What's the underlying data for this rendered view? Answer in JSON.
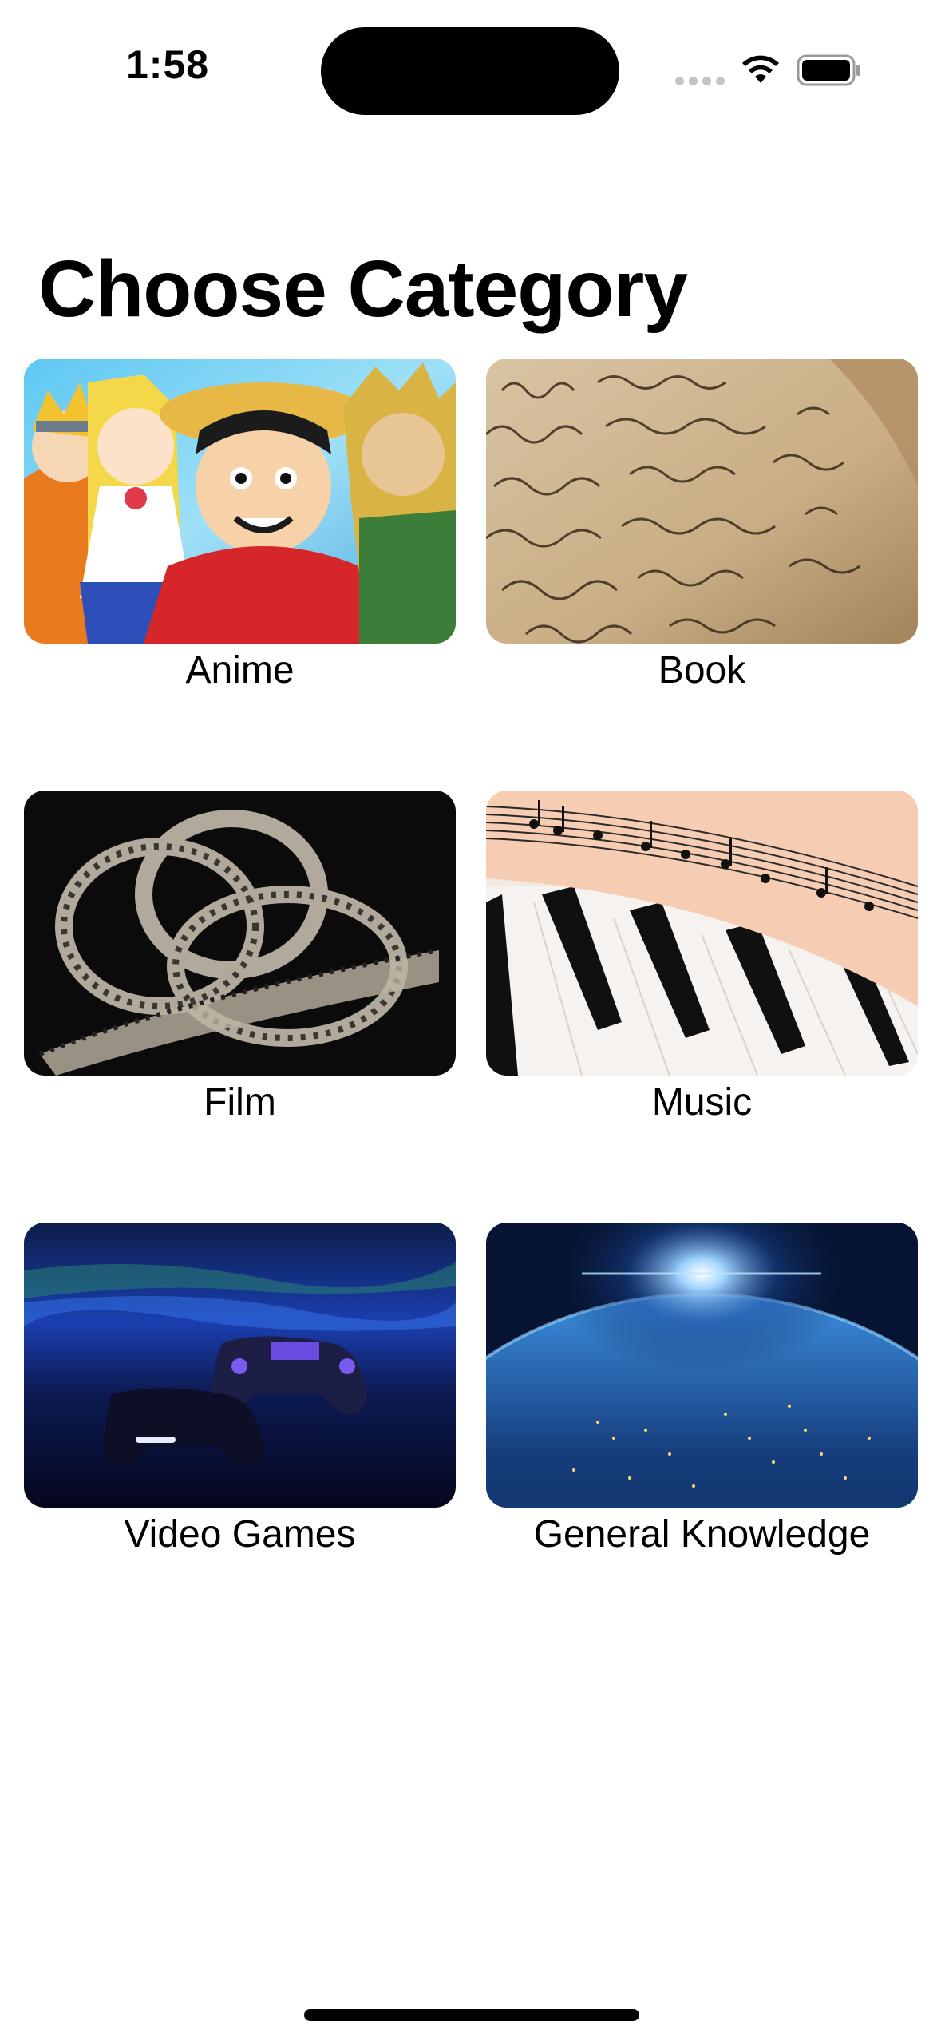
{
  "status_bar": {
    "time": "1:58"
  },
  "page": {
    "title": "Choose Category"
  },
  "categories": [
    {
      "label": "Anime",
      "image": "anime-characters-image"
    },
    {
      "label": "Book",
      "image": "handwritten-book-page-image"
    },
    {
      "label": "Film",
      "image": "film-reel-image"
    },
    {
      "label": "Music",
      "image": "sheet-music-piano-image"
    },
    {
      "label": "Video Games",
      "image": "game-controllers-image"
    },
    {
      "label": "General Knowledge",
      "image": "earth-from-space-image"
    }
  ]
}
